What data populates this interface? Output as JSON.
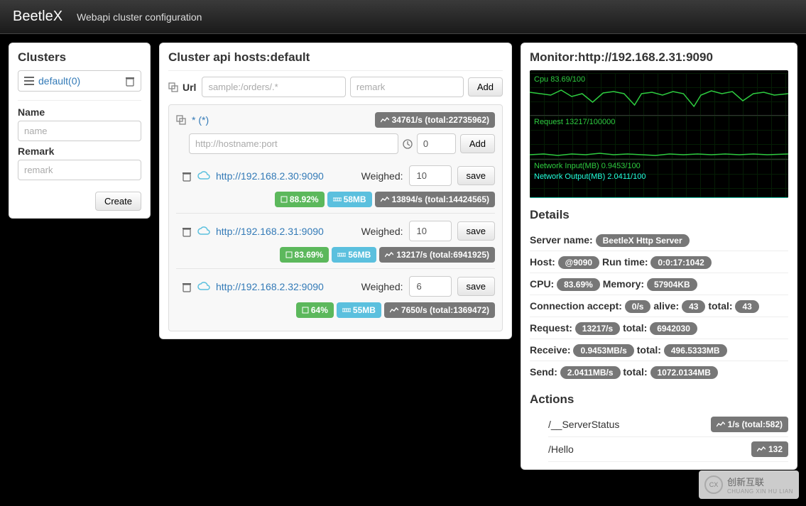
{
  "header": {
    "brand": "BeetleX",
    "nav": "Webapi cluster configuration"
  },
  "sidebar": {
    "title": "Clusters",
    "items": [
      {
        "name": "default(0)"
      }
    ],
    "nameLabel": "Name",
    "namePh": "name",
    "remarkLabel": "Remark",
    "remarkPh": "remark",
    "createBtn": "Create"
  },
  "center": {
    "title": "Cluster api hosts:default",
    "urlLabel": "Url",
    "urlPh": "sample:/orders/.*",
    "remarkPh": "remark",
    "addBtn": "Add",
    "pattern": {
      "label": "* (*)",
      "stat": "34761/s (total:22735962)",
      "hostPh": "http://hostname:port",
      "weightVal": "0",
      "addBtn": "Add",
      "weighedLabel": "Weighed:",
      "saveBtn": "save",
      "hosts": [
        {
          "url": "http://192.168.2.30:9090",
          "weight": "10",
          "cpu": "88.92%",
          "mem": "58MB",
          "stat": "13894/s (total:14424565)"
        },
        {
          "url": "http://192.168.2.31:9090",
          "weight": "10",
          "cpu": "83.69%",
          "mem": "56MB",
          "stat": "13217/s (total:6941925)"
        },
        {
          "url": "http://192.168.2.32:9090",
          "weight": "6",
          "cpu": "64%",
          "mem": "55MB",
          "stat": "7650/s (total:1369472)"
        }
      ]
    }
  },
  "monitor": {
    "title": "Monitor:http://192.168.2.31:9090",
    "cpuLine": "Cpu 83.69/100",
    "reqLine": "Request 13217/100000",
    "netIn": "Network Input(MB) 0.9453/100",
    "netOut": "Network Output(MB) 2.0411/100",
    "detailsTitle": "Details",
    "labels": {
      "serverName": "Server name: ",
      "host": "Host: ",
      "runtime": "Run time: ",
      "cpu": "CPU: ",
      "memory": "Memory: ",
      "connAccept": "Connection accept: ",
      "alive": "alive: ",
      "total": "total: ",
      "request": "Request: ",
      "receive": "Receive: ",
      "send": "Send: "
    },
    "vals": {
      "serverName": "BeetleX Http Server",
      "host": "@9090",
      "runtime": "0:0:17:1042",
      "cpu": "83.69%",
      "memory": "57904KB",
      "connAccept": "0/s",
      "connAlive": "43",
      "connTotal": "43",
      "reqRate": "13217/s",
      "reqTotal": "6942030",
      "recvRate": "0.9453MB/s",
      "recvTotal": "496.5333MB",
      "sendRate": "2.0411MB/s",
      "sendTotal": "1072.0134MB"
    },
    "actionsTitle": "Actions",
    "actions": [
      {
        "path": "/__ServerStatus",
        "stat": "1/s (total:582)"
      },
      {
        "path": "/Hello",
        "stat": "132"
      }
    ]
  },
  "watermark": {
    "cn": "创新互联",
    "py": "CHUANG XIN HU LIAN"
  },
  "chart_data": [
    {
      "type": "line",
      "title": "Cpu 83.69/100",
      "ylim": [
        0,
        100
      ],
      "values": [
        80,
        82,
        70,
        78,
        85,
        60,
        78,
        82,
        84,
        75,
        85,
        65,
        82,
        88,
        80,
        72,
        82,
        86,
        75,
        83
      ]
    },
    {
      "type": "line",
      "title": "Request 13217/100000",
      "ylim": [
        0,
        100000
      ],
      "values": [
        13000,
        13100,
        12900,
        13400,
        13200,
        12800,
        13250,
        13300,
        13000,
        13217
      ]
    },
    {
      "type": "line",
      "title": "Network Input(MB) 0.9453/100",
      "ylim": [
        0,
        100
      ],
      "values": [
        0.9,
        0.95,
        0.92,
        0.93,
        0.94,
        0.95,
        0.9453
      ],
      "series2": {
        "name": "Network Output(MB) 2.0411/100",
        "values": [
          2.0,
          2.05,
          1.98,
          2.1,
          2.02,
          2.04,
          2.0411
        ]
      }
    }
  ]
}
